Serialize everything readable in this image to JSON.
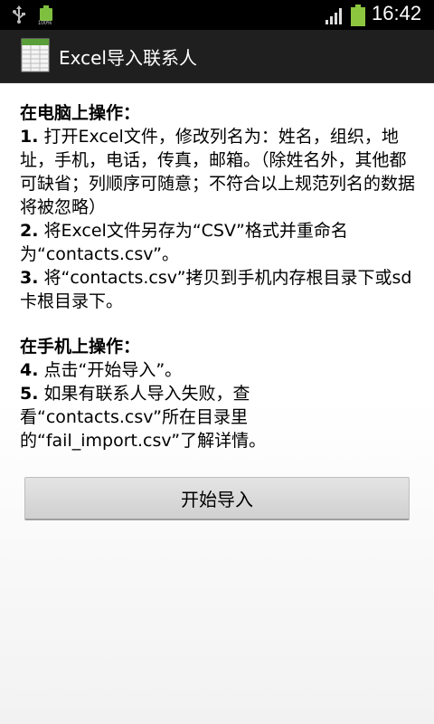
{
  "status_bar": {
    "time": "16:42",
    "small_battery_percent": "100%",
    "icons": [
      "usb-icon",
      "battery-small-icon",
      "signal-icon",
      "battery-icon"
    ]
  },
  "action_bar": {
    "title": "Excel导入联系人",
    "icon": "spreadsheet-app-icon"
  },
  "instructions": {
    "pc_heading": "在电脑上操作：",
    "step1_num": "1.",
    "step1_text": " 打开Excel文件，修改列名为：姓名，组织，地址，手机，电话，传真，邮箱。（除姓名外，其他都可缺省；列顺序可随意；不符合以上规范列名的数据将被忽略）",
    "step2_num": "2.",
    "step2_text": " 将Excel文件另存为“CSV”格式并重命名为“contacts.csv”。",
    "step3_num": "3.",
    "step3_text": " 将“contacts.csv”拷贝到手机内存根目录下或sd卡根目录下。",
    "phone_heading": "在手机上操作：",
    "step4_num": "4.",
    "step4_text": " 点击“开始导入”。",
    "step5_num": "5.",
    "step5_line1": " 如果有联系人导入失败，查",
    "step5_line2": "看“contacts.csv”所在目录里",
    "step5_line3": "的“fail_import.csv”了解详情。"
  },
  "buttons": {
    "start_import": "开始导入"
  },
  "colors": {
    "status_bar_bg": "#000000",
    "action_bar_bg": "#1f1f1f",
    "battery_green": "#8cc63f",
    "button_bg": "#dadada"
  }
}
